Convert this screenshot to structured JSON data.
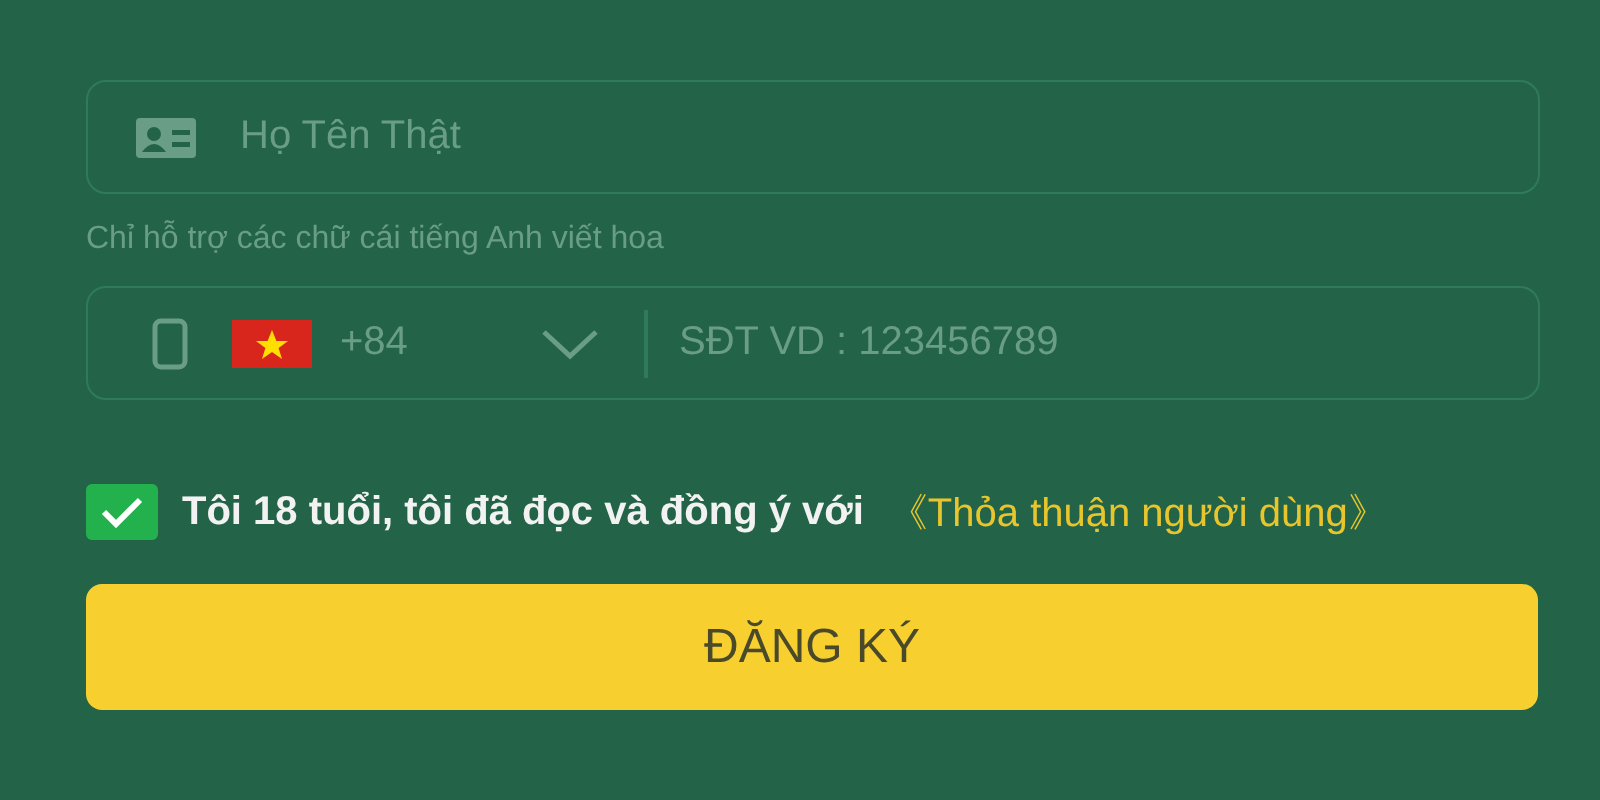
{
  "name_field": {
    "placeholder": "Họ Tên Thật"
  },
  "name_hint": "Chỉ hỗ trợ các chữ cái tiếng Anh viết hoa",
  "phone_field": {
    "country_code": "+84",
    "placeholder": "SĐT VD : 123456789"
  },
  "agreement": {
    "checked": true,
    "text": "Tôi 18 tuổi, tôi đã đọc và đồng ý với",
    "link": "《Thỏa thuận người dùng》"
  },
  "submit_button": "ĐĂNG KÝ"
}
